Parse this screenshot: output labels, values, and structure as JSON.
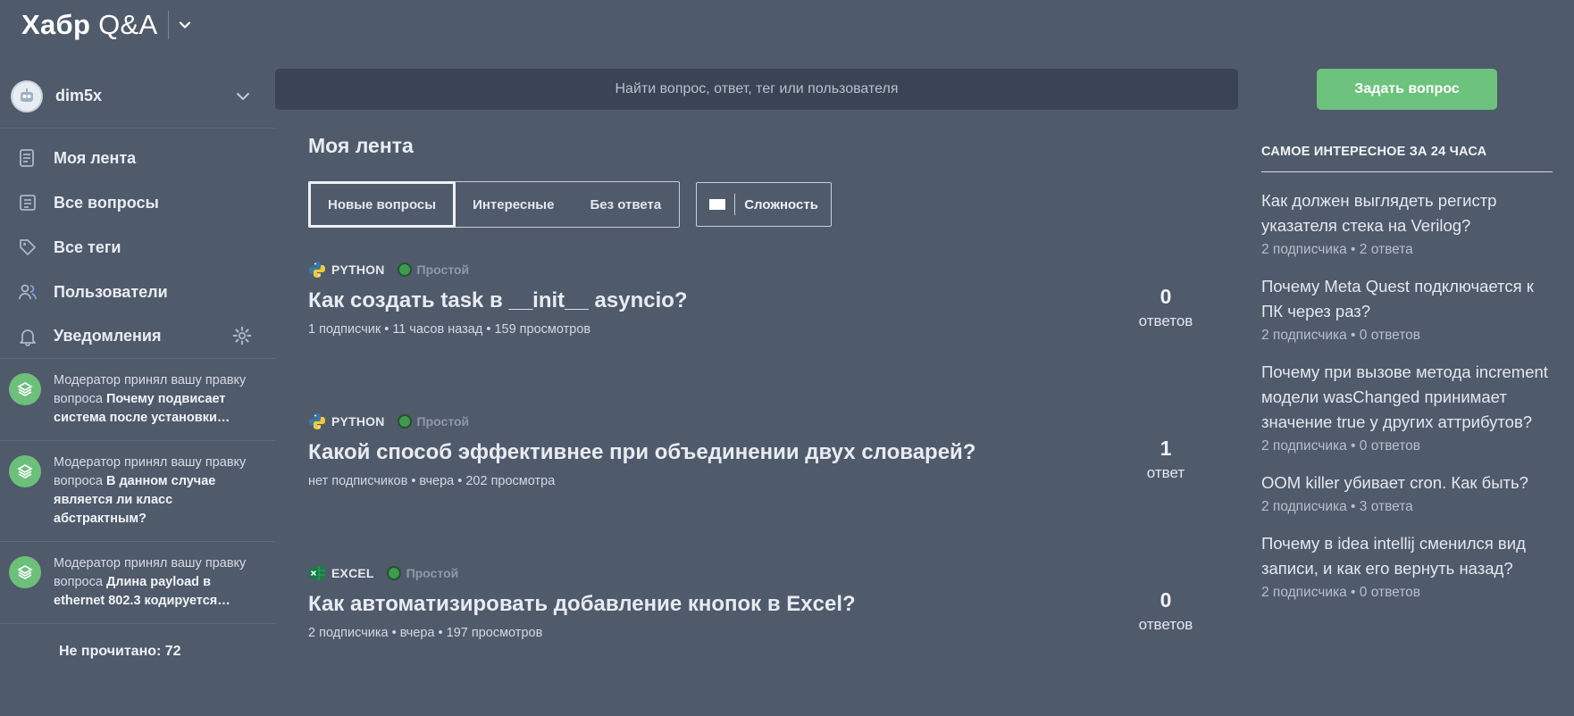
{
  "app": {
    "logo_bold": "Хабр",
    "logo_rest": " Q&A"
  },
  "user": {
    "name": "dim5x"
  },
  "search": {
    "placeholder": "Найти вопрос, ответ, тег или пользователя"
  },
  "ask_button": "Задать вопрос",
  "sidebar": {
    "items": [
      {
        "label": "Моя лента",
        "icon": "feed-icon"
      },
      {
        "label": "Все вопросы",
        "icon": "questions-icon"
      },
      {
        "label": "Все теги",
        "icon": "tag-icon"
      },
      {
        "label": "Пользователи",
        "icon": "users-icon"
      },
      {
        "label": "Уведомления",
        "icon": "bell-icon"
      }
    ],
    "notifications": [
      {
        "prefix": "Модератор принял вашу правку вопроса ",
        "bold": "Почему подвисает система после установки…"
      },
      {
        "prefix": "Модератор принял вашу правку вопроса ",
        "bold": "В данном случае является ли класс абстрактным?"
      },
      {
        "prefix": "Модератор принял вашу правку вопроса ",
        "bold": "Длина payload в ethernet 802.3 кодируется…"
      }
    ],
    "unread": "Не прочитано: 72"
  },
  "main": {
    "title": "Моя лента",
    "tabs": [
      "Новые вопросы",
      "Интересные",
      "Без ответа"
    ],
    "complexity_label": "Сложность",
    "questions": [
      {
        "tag": "PYTHON",
        "tag_icon": "python-icon",
        "difficulty": "Простой",
        "title": "Как создать task в __init__ asyncio?",
        "meta": "1 подписчик • 11 часов назад • 159 просмотров",
        "answers_count": "0",
        "answers_label": "ответов"
      },
      {
        "tag": "PYTHON",
        "tag_icon": "python-icon",
        "difficulty": "Простой",
        "title": "Какой способ эффективнее при объединении двух словарей?",
        "meta": "нет подписчиков • вчера • 202 просмотра",
        "answers_count": "1",
        "answers_label": "ответ"
      },
      {
        "tag": "EXCEL",
        "tag_icon": "excel-icon",
        "difficulty": "Простой",
        "title": "Как автоматизировать добавление кнопок в Excel?",
        "meta": "2 подписчика • вчера • 197 просмотров",
        "answers_count": "0",
        "answers_label": "ответов"
      }
    ]
  },
  "right": {
    "title": "САМОЕ ИНТЕРЕСНОЕ ЗА 24 ЧАСА",
    "items": [
      {
        "title": "Как должен выглядеть регистр указателя стека на Verilog?",
        "meta": "2 подписчика • 2 ответа"
      },
      {
        "title": "Почему Meta Quest подключается к ПК через раз?",
        "meta": "2 подписчика • 0 ответов"
      },
      {
        "title": "Почему при вызове метода increment модели wasChanged принимает значение true у других аттрибутов?",
        "meta": "2 подписчика • 0 ответов"
      },
      {
        "title": "OOM killer убивает cron. Как быть?",
        "meta": "2 подписчика • 3 ответа"
      },
      {
        "title": "Почему в idea intellij сменился вид записи, и как его вернуть назад?",
        "meta": "2 подписчика • 0 ответов"
      }
    ]
  },
  "colors": {
    "background": "#4f5a6b",
    "search_bg": "#3b4455",
    "accent_green": "#6dc27d",
    "difficulty_green": "#3e9a4d"
  }
}
